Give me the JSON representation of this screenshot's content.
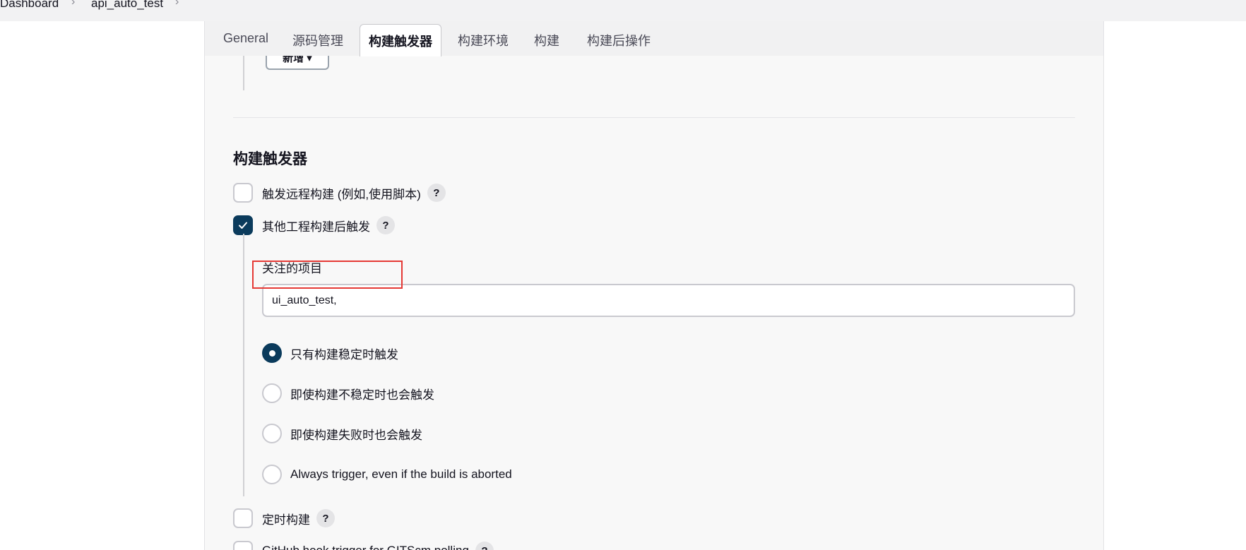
{
  "breadcrumb": {
    "items": [
      "Dashboard",
      "api_auto_test"
    ],
    "separator": ">"
  },
  "tabs": [
    {
      "label": "General",
      "active": false
    },
    {
      "label": "源码管理",
      "active": false
    },
    {
      "label": "构建触发器",
      "active": true
    },
    {
      "label": "构建环境",
      "active": false
    },
    {
      "label": "构建",
      "active": false
    },
    {
      "label": "构建后操作",
      "active": false
    }
  ],
  "add_button_label": "新增 ▾",
  "section": {
    "title": "构建触发器",
    "triggers": [
      {
        "label": "触发远程构建 (例如,使用脚本)",
        "checked": false,
        "help": "?"
      },
      {
        "label": "其他工程构建后触发",
        "checked": true,
        "help": "?"
      },
      {
        "label": "定时构建",
        "checked": false,
        "help": "?"
      },
      {
        "label": "GitHub hook trigger for GITScm polling",
        "checked": false,
        "help": "?"
      }
    ]
  },
  "watched_projects": {
    "label": "关注的项目",
    "value": "ui_auto_test,"
  },
  "trigger_conditions": [
    {
      "label": "只有构建稳定时触发",
      "selected": true
    },
    {
      "label": "即使构建不稳定时也会触发",
      "selected": false
    },
    {
      "label": "即使构建失败时也会触发",
      "selected": false
    },
    {
      "label": "Always trigger, even if the build is aborted",
      "selected": false
    }
  ],
  "colors": {
    "accent": "#0b3b5c",
    "highlight": "#e53935"
  },
  "icons": {
    "breadcrumb_separator": "chevron-right-icon",
    "checkbox_checked": "check-icon",
    "help": "help-icon"
  }
}
